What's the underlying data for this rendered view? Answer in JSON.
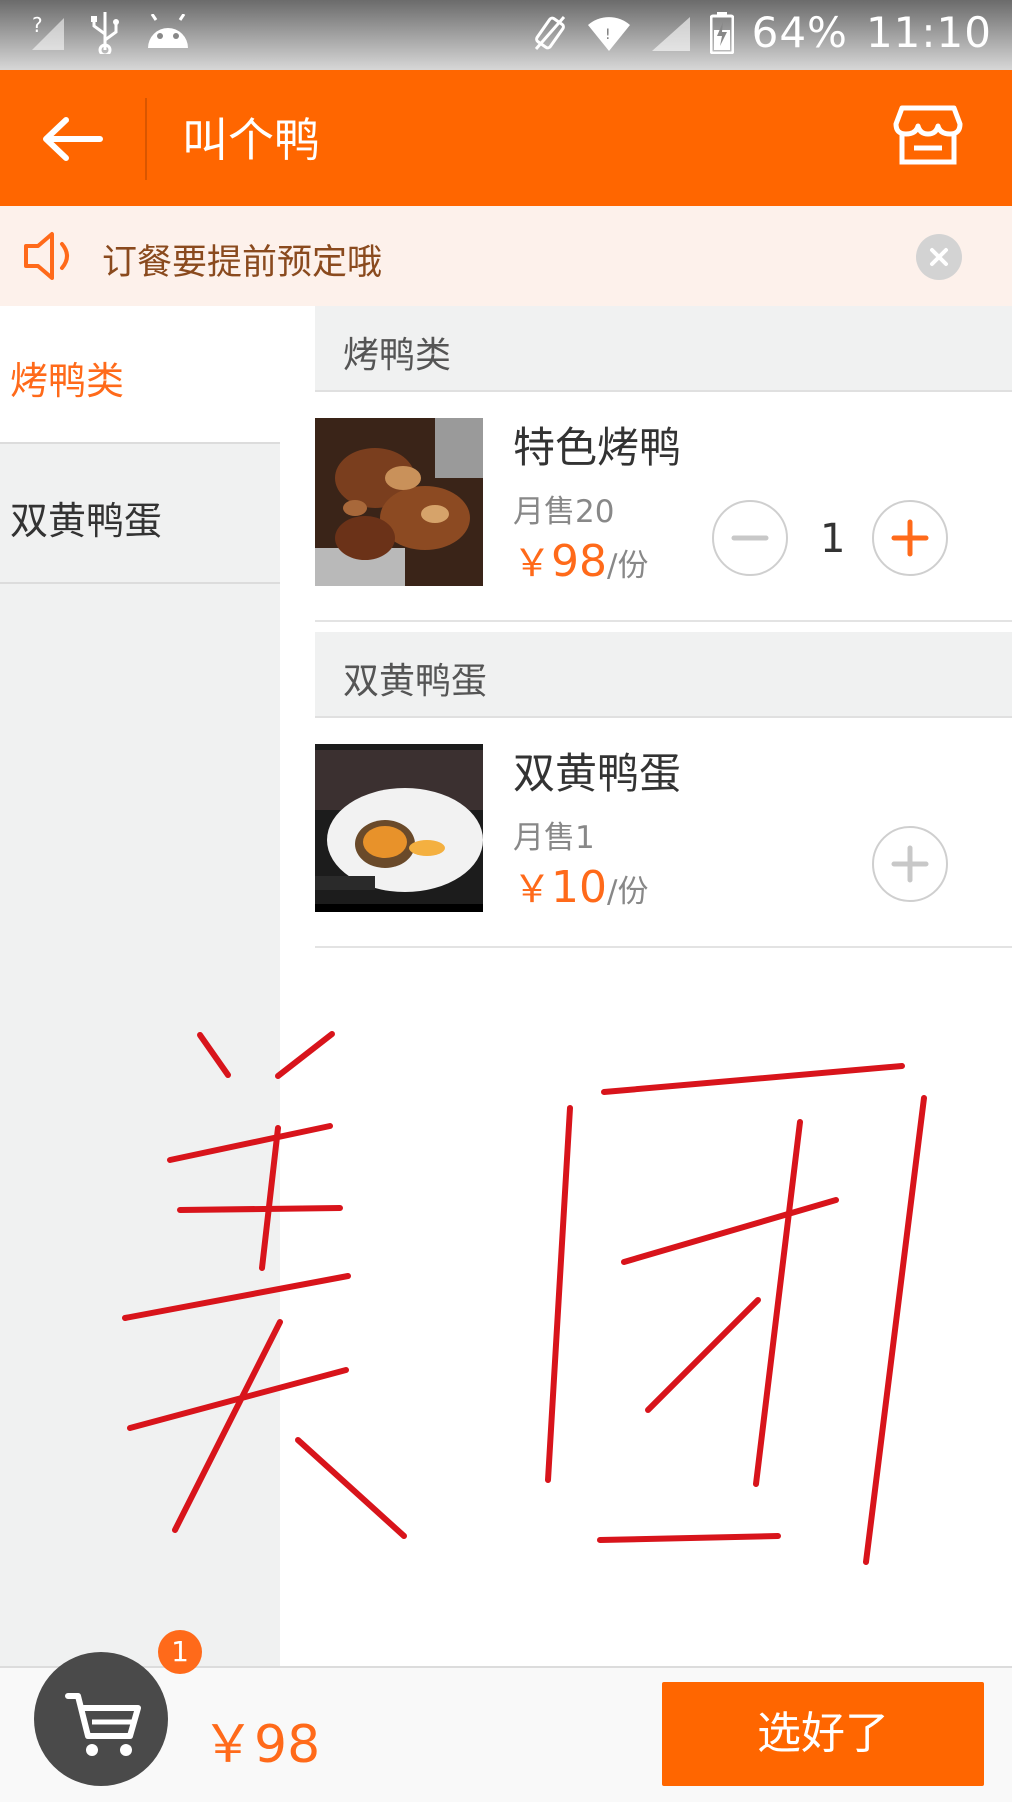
{
  "status_bar": {
    "battery": "64%",
    "time": "11:10"
  },
  "app_bar": {
    "title": "叫个鸭"
  },
  "notice": {
    "text": "订餐要提前预定哦"
  },
  "sidebar": {
    "items": [
      {
        "label": "烤鸭类",
        "active": true
      },
      {
        "label": "双黄鸭蛋",
        "active": false
      }
    ]
  },
  "sections": [
    {
      "title": "烤鸭类",
      "dishes": [
        {
          "name": "特色烤鸭",
          "sales": "月售20",
          "currency": "￥",
          "price": "98",
          "unit": "/份",
          "quantity": "1"
        }
      ]
    },
    {
      "title": "双黄鸭蛋",
      "dishes": [
        {
          "name": "双黄鸭蛋",
          "sales": "月售1",
          "currency": "￥",
          "price": "10",
          "unit": "/份"
        }
      ]
    }
  ],
  "overlay_text": "美团",
  "cart": {
    "badge": "1",
    "total": "￥98"
  },
  "submit": {
    "label": "选好了"
  },
  "colors": {
    "accent": "#ff6600",
    "price": "#ff6a1a",
    "overlay_stroke": "#d8141b"
  }
}
